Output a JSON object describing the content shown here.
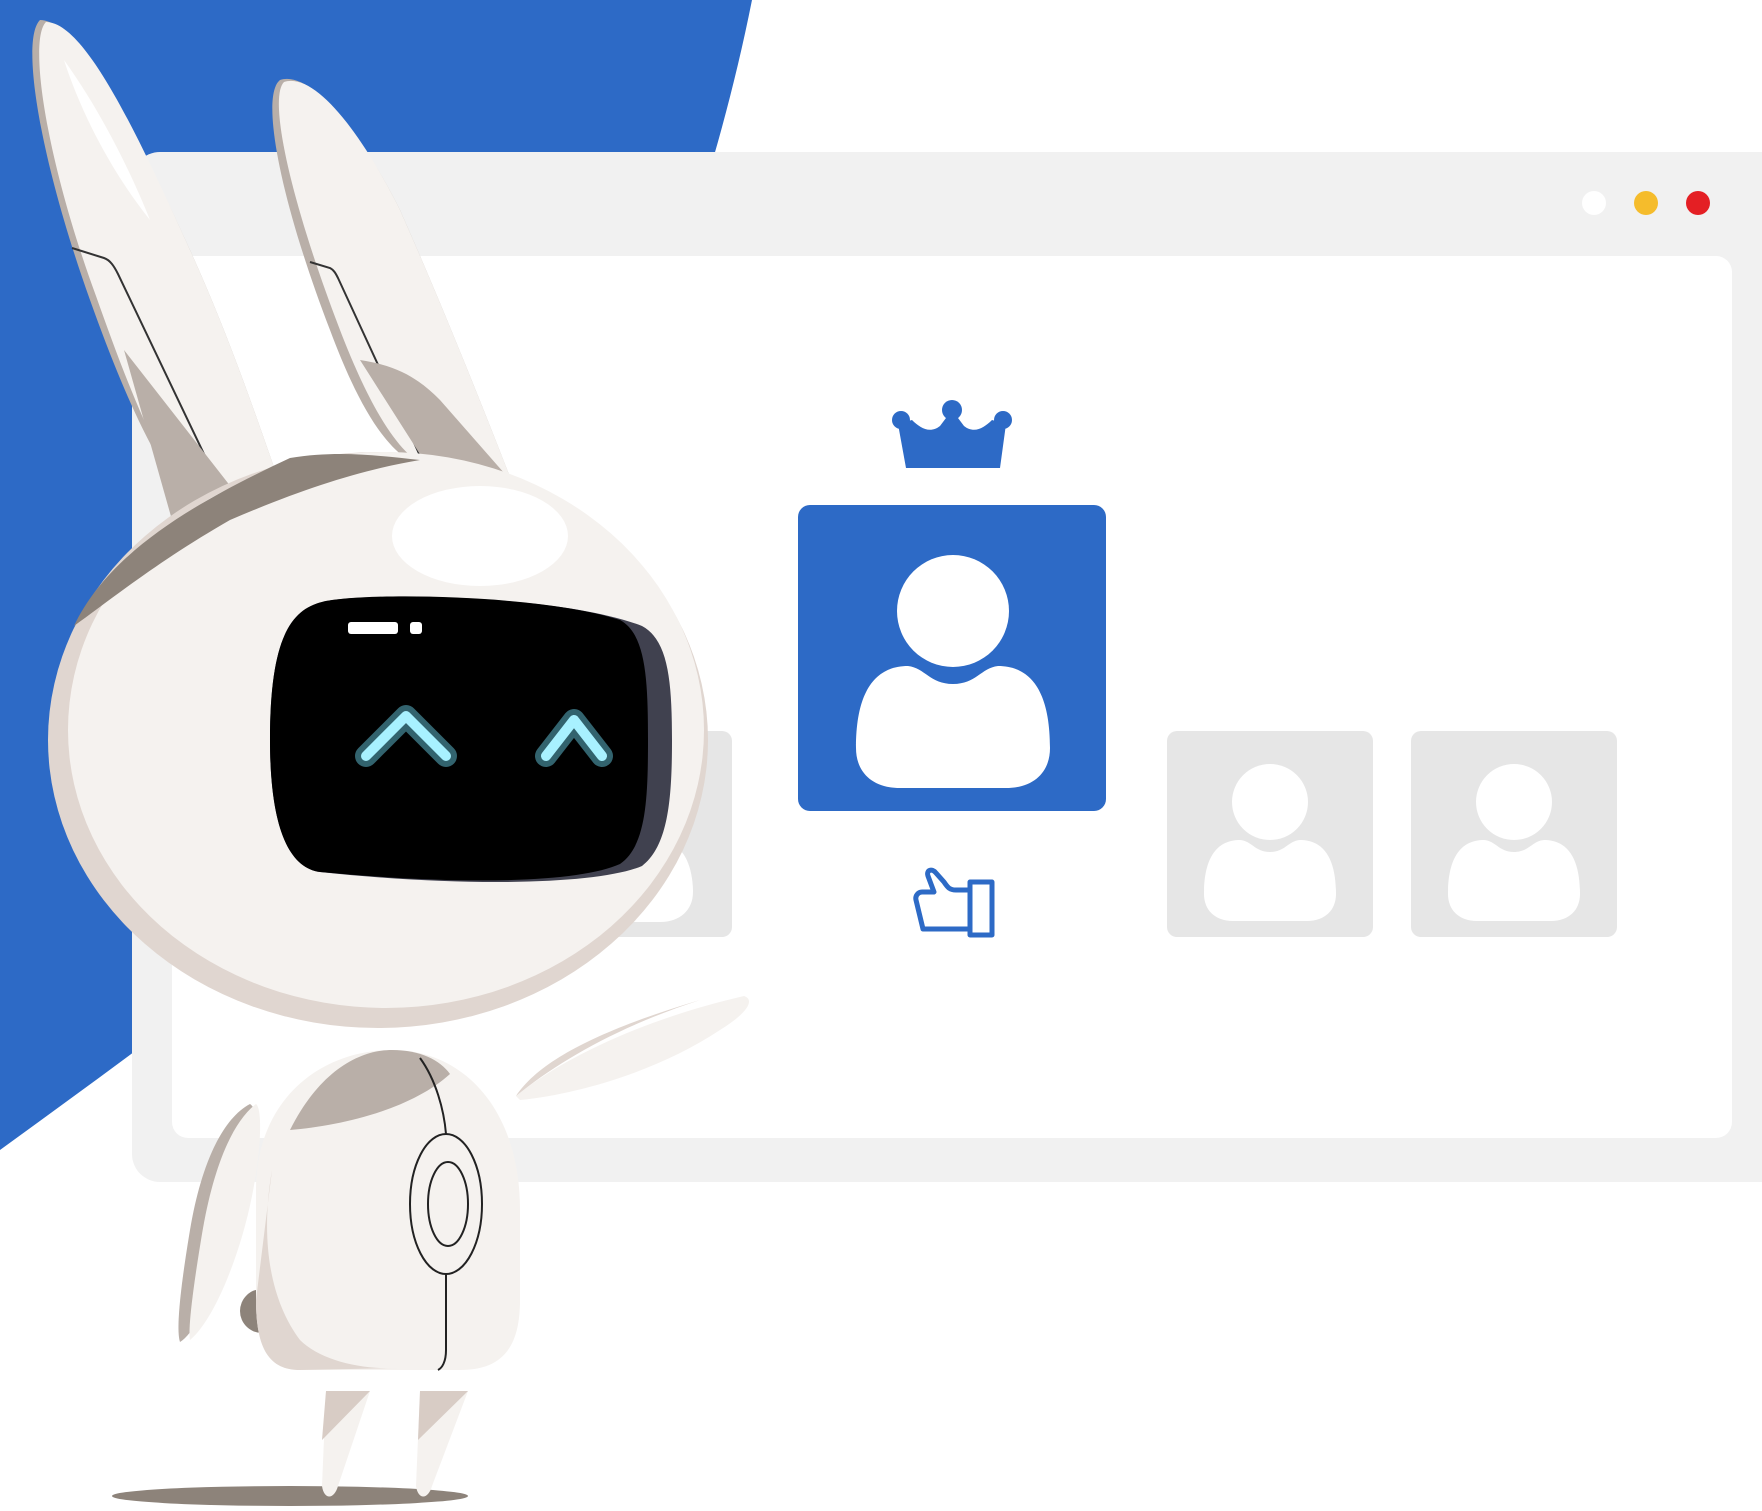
{
  "colors": {
    "background": "#ffffff",
    "accent_blue": "#2d6ac6",
    "window_frame": "#f1f1f1",
    "window_content": "#ffffff",
    "placeholder_card": "#e6e6e6",
    "dot_white": "#ffffff",
    "dot_yellow": "#f5bc2c",
    "dot_red": "#e41f24",
    "robot_body": "#f5f2ef",
    "robot_shadow": "#b9afa8",
    "robot_dark": "#8d837a",
    "visor": "#000000",
    "eye_glow": "#a8f1ff"
  },
  "window": {
    "dots": [
      {
        "name": "window-dot-white",
        "color": "#ffffff"
      },
      {
        "name": "window-dot-yellow",
        "color": "#f5bc2c"
      },
      {
        "name": "window-dot-red",
        "color": "#e41f24"
      }
    ],
    "cards": [
      {
        "name": "featured-user-card",
        "state": "selected",
        "icon": "user-icon"
      },
      {
        "name": "user-card-placeholder-left",
        "state": "unselected",
        "icon": "user-icon"
      },
      {
        "name": "user-card-placeholder-middle",
        "state": "unselected",
        "icon": "user-icon"
      },
      {
        "name": "user-card-placeholder-right",
        "state": "unselected",
        "icon": "user-icon"
      }
    ],
    "badges": {
      "crown": "crown-icon",
      "like": "thumbs-up-icon"
    }
  },
  "robot": {
    "character": "bunny-robot-mascot",
    "expression": "happy"
  }
}
